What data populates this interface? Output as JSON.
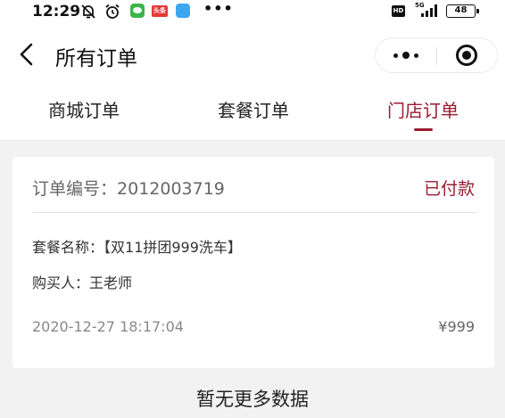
{
  "status_bar": {
    "time": "12:29",
    "toutiao_badge": "头条",
    "more": "•••",
    "hd": "HD",
    "network": "5G",
    "battery": "48"
  },
  "nav": {
    "title": "所有订单"
  },
  "tabs": [
    {
      "label": "商城订单",
      "active": false
    },
    {
      "label": "套餐订单",
      "active": false
    },
    {
      "label": "门店订单",
      "active": true
    }
  ],
  "order": {
    "number_label": "订单编号：",
    "number": "2012003719",
    "status": "已付款",
    "package_label": "套餐名称：",
    "package_name": "【双11拼团999洗车】",
    "buyer_label": "购买人：",
    "buyer": "王老师",
    "time": "2020-12-27 18:17:04",
    "price": "¥999"
  },
  "footer": {
    "no_more": "暂无更多数据"
  },
  "colors": {
    "accent": "#9b1b30",
    "background": "#f2f2f2"
  }
}
